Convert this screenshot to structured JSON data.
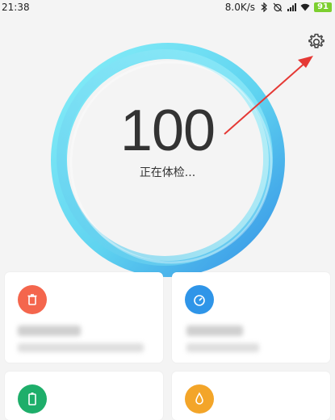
{
  "status_bar": {
    "time": "21:38",
    "network_speed": "8.0K/s",
    "battery_level": "91",
    "icons": [
      "bluetooth-icon",
      "alarm-off-icon",
      "signal-icon",
      "wifi-icon",
      "battery-icon"
    ]
  },
  "header": {
    "settings_icon": "gear-icon"
  },
  "gauge": {
    "score": "100",
    "status": "正在体检..."
  },
  "cards": [
    {
      "icon": "trash-icon",
      "icon_color": "#f4664d",
      "blurred": true
    },
    {
      "icon": "speed-icon",
      "icon_color": "#2f95e8",
      "blurred": true
    },
    {
      "icon": "battery-icon",
      "icon_color": "#1eae6a",
      "blurred": true
    },
    {
      "icon": "drop-icon",
      "icon_color": "#f3a529",
      "blurred": true
    }
  ],
  "colors": {
    "ring_light": "#7de7f4",
    "ring_blue": "#3d9be9",
    "annotation_arrow": "#e53935"
  }
}
